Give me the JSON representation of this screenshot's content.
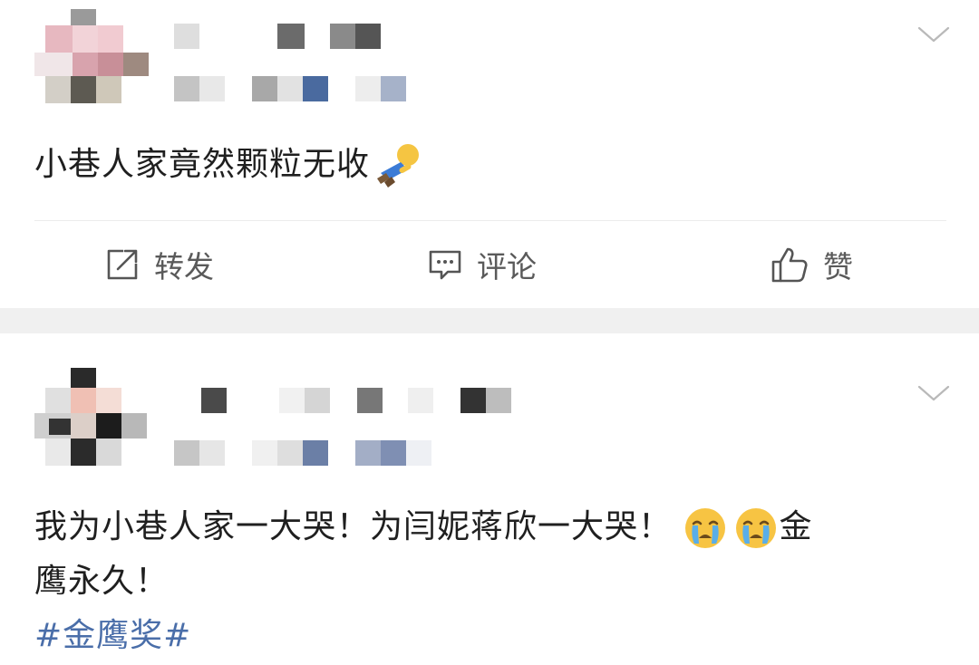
{
  "posts": [
    {
      "text": "小巷人家竟然颗粒无收",
      "emoji_icon": "falling-person-emoji",
      "actions": [
        {
          "icon": "share-icon",
          "label": "转发"
        },
        {
          "icon": "comment-icon",
          "label": "评论"
        },
        {
          "icon": "thumbs-up-icon",
          "label": "赞"
        }
      ]
    },
    {
      "text_line1": "我为小巷人家一大哭！为闫妮蒋欣一大哭！",
      "emoji_icons": [
        "crying-face-emoji",
        "crying-face-emoji"
      ],
      "text_after_emoji": "金",
      "text_line2": "鹰永久！",
      "topic": "#金鹰奖#"
    }
  ],
  "colors": {
    "topic_link": "#4a6ea9",
    "separator": "#f0f0f0",
    "action_text": "#5a5a5a"
  }
}
